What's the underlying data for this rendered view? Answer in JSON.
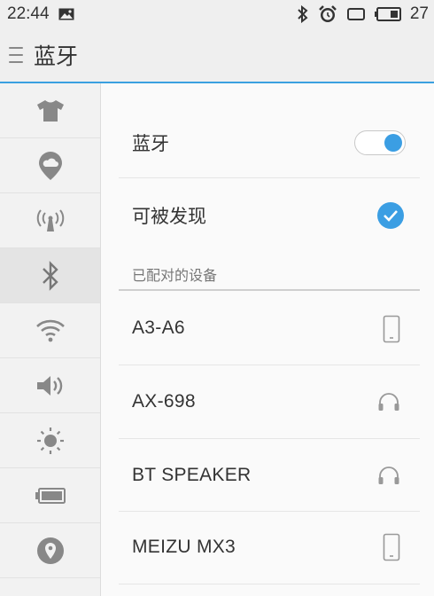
{
  "status_bar": {
    "time": "22:44",
    "battery_percent": "27",
    "icons": [
      "image-icon",
      "bluetooth-icon",
      "alarm-icon",
      "rotation-icon",
      "battery-icon"
    ]
  },
  "app_bar": {
    "title": "蓝牙",
    "menu_icon": "menu-icon"
  },
  "sidebar": {
    "items": [
      {
        "icon": "theme-shirt-icon",
        "active": false
      },
      {
        "icon": "cloud-icon",
        "active": false
      },
      {
        "icon": "hotspot-icon",
        "active": false
      },
      {
        "icon": "bluetooth-icon",
        "active": true
      },
      {
        "icon": "wifi-icon",
        "active": false
      },
      {
        "icon": "volume-icon",
        "active": false
      },
      {
        "icon": "brightness-icon",
        "active": false
      },
      {
        "icon": "battery-icon",
        "active": false
      },
      {
        "icon": "location-icon",
        "active": false
      }
    ]
  },
  "settings": {
    "bluetooth_label": "蓝牙",
    "bluetooth_enabled": true,
    "discoverable_label": "可被发现",
    "discoverable_checked": true
  },
  "paired_section": {
    "header": "已配对的设备",
    "devices": [
      {
        "name": "A3-A6",
        "icon": "phone-icon"
      },
      {
        "name": "AX-698",
        "icon": "headphones-icon"
      },
      {
        "name": "BT SPEAKER",
        "icon": "headphones-icon"
      },
      {
        "name": "MEIZU MX3",
        "icon": "phone-icon"
      }
    ]
  },
  "colors": {
    "accent": "#3b9ee3",
    "background": "#fafafa",
    "sidebar_bg": "#f2f2f2",
    "icon_gray": "#888888"
  }
}
